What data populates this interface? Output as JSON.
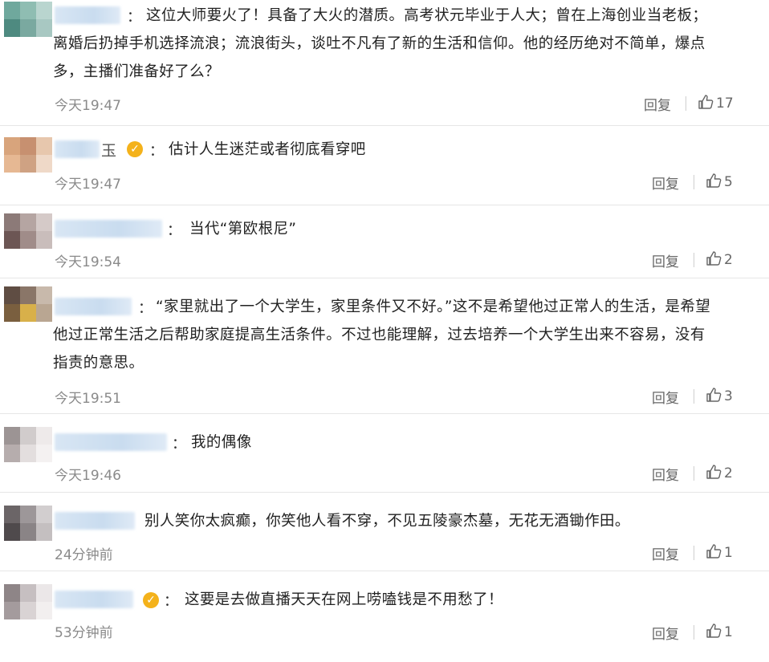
{
  "comments": [
    {
      "name_suffix": "",
      "verified": false,
      "text": [
        "这位大师要火了！具备了大火的潜质。高考状元毕业于人大；曾在上海创业当老板；",
        "离婚后扔掉手机选择流浪；流浪街头，谈吐不凡有了新的生活和信仰。他的经历绝对不简单，爆点",
        "多，主播们准备好了么？"
      ],
      "time": "今天19:47",
      "reply": "回复",
      "likes": "17"
    },
    {
      "name_suffix": "玉",
      "verified": true,
      "text": [
        "估计人生迷茫或者彻底看穿吧"
      ],
      "time": "今天19:47",
      "reply": "回复",
      "likes": "5"
    },
    {
      "name_suffix": "",
      "verified": false,
      "text": [
        "当代“第欧根尼”"
      ],
      "time": "今天19:54",
      "reply": "回复",
      "likes": "2"
    },
    {
      "name_suffix": "",
      "verified": false,
      "text": [
        "“家里就出了一个大学生，家里条件又不好。”这不是希望他过正常人的生活，是希望",
        "他过正常生活之后帮助家庭提高生活条件。不过也能理解，过去培养一个大学生出来不容易，没有",
        "指责的意思。"
      ],
      "time": "今天19:51",
      "reply": "回复",
      "likes": "3"
    },
    {
      "name_suffix": "",
      "verified": false,
      "text": [
        "我的偶像"
      ],
      "time": "今天19:46",
      "reply": "回复",
      "likes": "2"
    },
    {
      "name_suffix": "",
      "verified": false,
      "text": [
        "别人笑你太疯癫，你笑他人看不穿，不见五陵豪杰墓，无花无酒锄作田。"
      ],
      "time": "24分钟前",
      "reply": "回复",
      "likes": "1"
    },
    {
      "name_suffix": "",
      "verified": true,
      "text": [
        "这要是去做直播天天在网上唠嗑钱是不用愁了！"
      ],
      "time": "53分钟前",
      "reply": "回复",
      "likes": "1"
    }
  ],
  "colors": {
    "verified_badge": "#f4b21b",
    "blurred_name": "#c9dcef",
    "time_text": "#8a8a8a"
  },
  "icons": {
    "like": "thumbs-up-icon",
    "verified": "verified-badge-icon"
  }
}
